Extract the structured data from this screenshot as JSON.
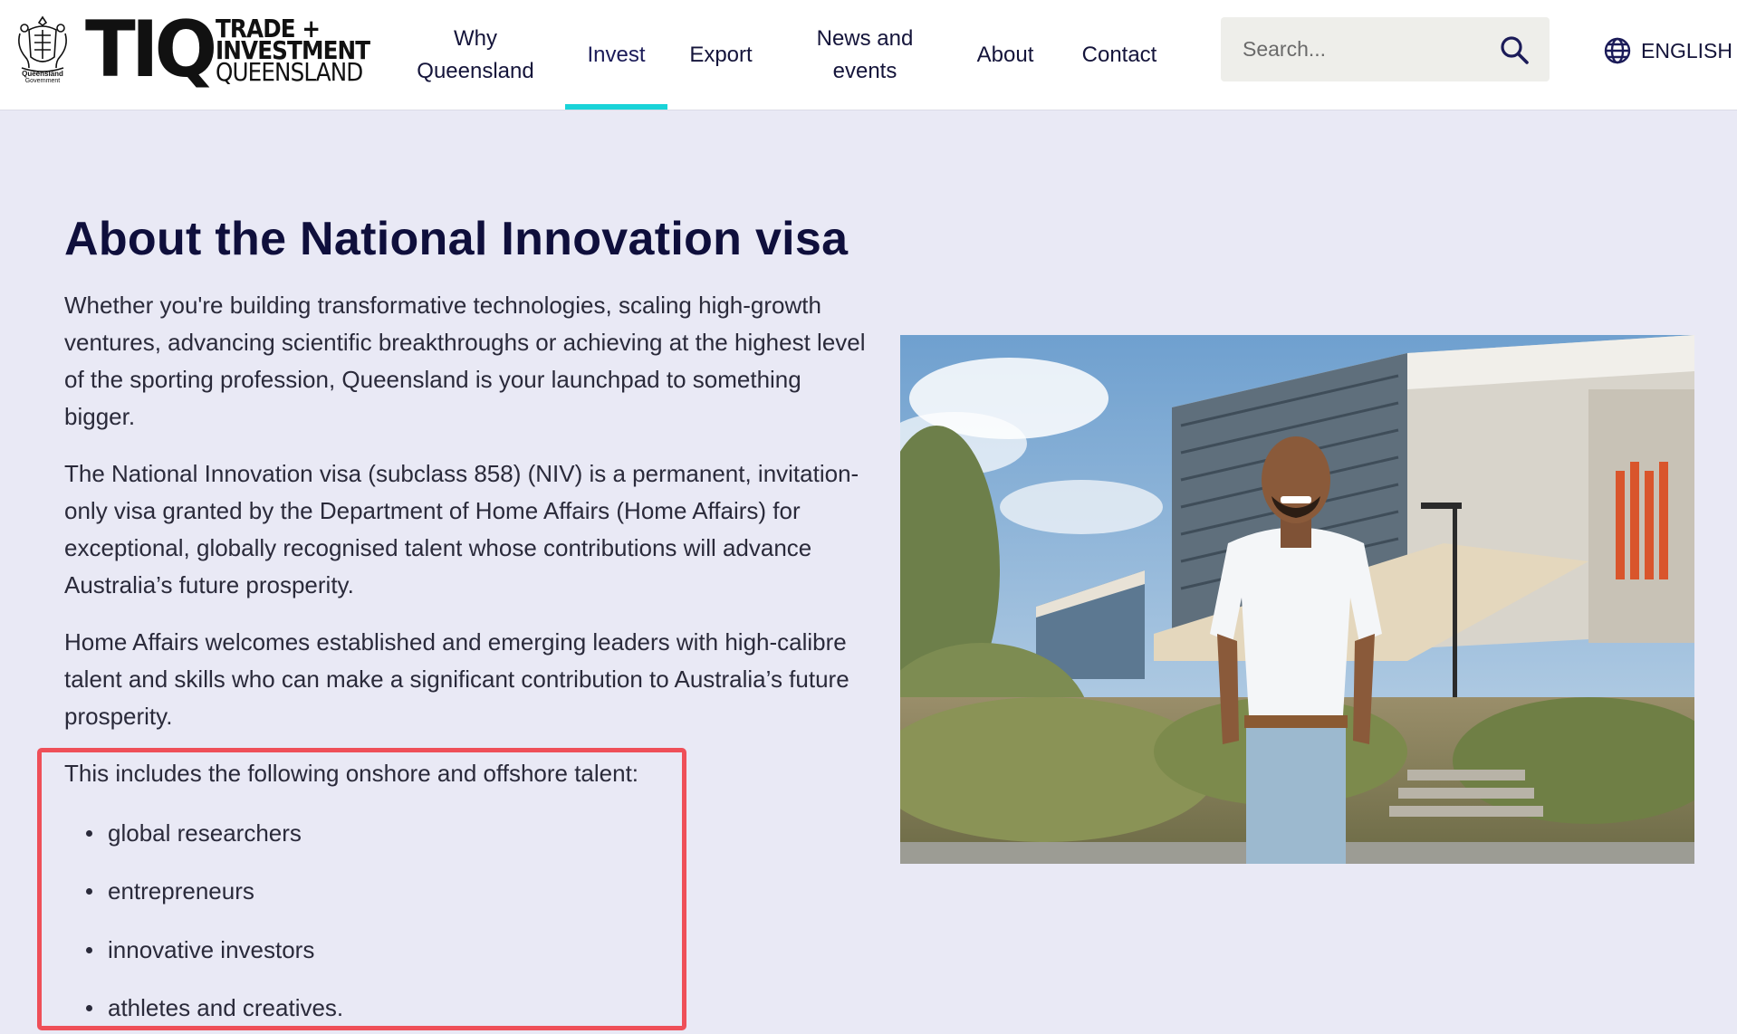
{
  "header": {
    "gov_logo": {
      "name": "queensland-government-crest",
      "line1": "Queensland",
      "line2": "Government"
    },
    "brand": {
      "mark": "TIQ",
      "line1": "TRADE +",
      "line2": "INVESTMENT",
      "line3": "QUEENSLAND"
    },
    "nav": [
      {
        "label": "Why Queensland",
        "active": false
      },
      {
        "label": "Invest",
        "active": true
      },
      {
        "label": "Export",
        "active": false
      },
      {
        "label": "News and events",
        "active": false
      },
      {
        "label": "About",
        "active": false
      },
      {
        "label": "Contact",
        "active": false
      }
    ],
    "search": {
      "placeholder": "Search...",
      "icon": "search-icon"
    },
    "language": {
      "label": "ENGLISH",
      "icon": "globe-icon"
    },
    "colors": {
      "active_underline": "#19d3d8",
      "text": "#14143a"
    }
  },
  "main": {
    "title": "About the National Innovation visa",
    "paragraphs": [
      "Whether you're building transformative technologies, scaling high-growth ventures, advancing scientific breakthroughs or achieving at the highest level of the sporting profession, Queensland is your launchpad to something bigger.",
      "The National Innovation visa (subclass 858) (NIV) is a permanent, invitation-only visa granted by the Department of Home Affairs (Home Affairs) for exceptional, globally recognised talent whose contributions will advance Australia’s future prosperity.",
      "Home Affairs welcomes established and emerging leaders with high-calibre talent and skills who can make a significant contribution to Australia’s future prosperity."
    ],
    "talent_intro": "This includes the following onshore and offshore talent:",
    "talent_list": [
      "global researchers",
      "entrepreneurs",
      "innovative investors",
      "athletes and creatives."
    ],
    "highlight_color": "#ef4f58"
  },
  "hero_image": {
    "subject": "man in white t-shirt standing in front of modern university building"
  },
  "colors": {
    "page_background": "#e9e9f5",
    "header_background": "#ffffff",
    "title": "#0f0f3c"
  }
}
